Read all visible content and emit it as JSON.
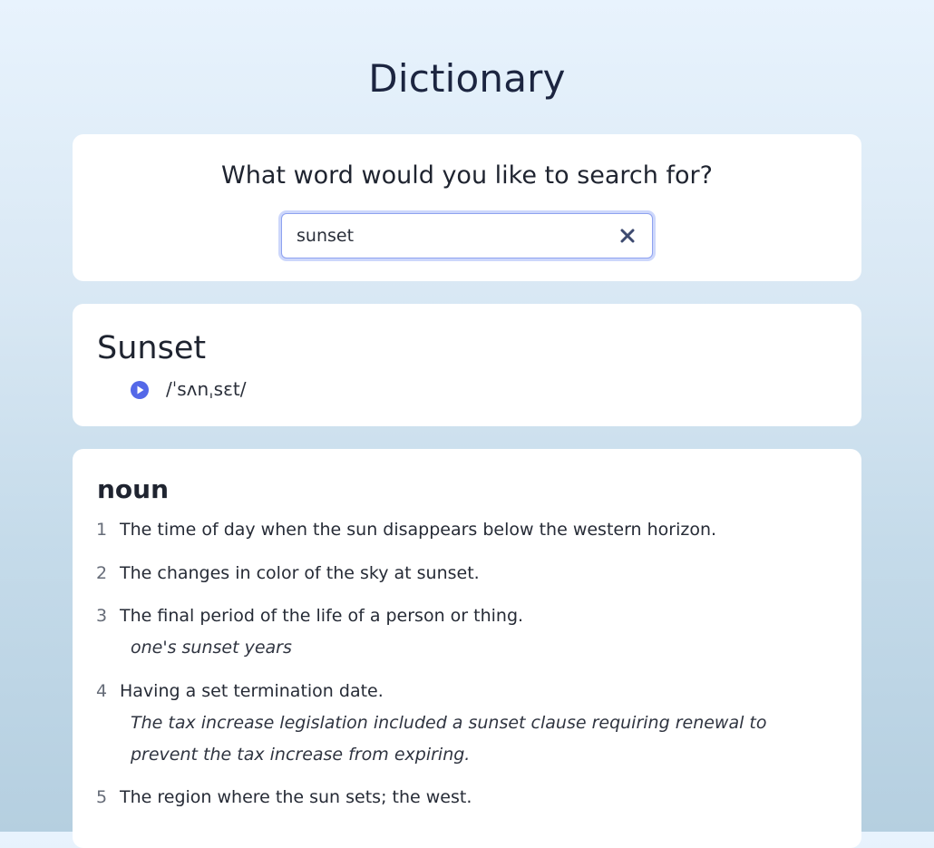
{
  "header": {
    "title": "Dictionary"
  },
  "search": {
    "prompt": "What word would you like to search for?",
    "value": "sunset",
    "clear_icon": "close-icon"
  },
  "entry": {
    "word": "Sunset",
    "phonetic": "/ˈsʌnˌsɛt/",
    "play_icon": "play-circle-icon",
    "accent_color": "#5468e8",
    "part_of_speech": "noun",
    "definitions": [
      {
        "number": "1",
        "text": "The time of day when the sun disappears below the western horizon."
      },
      {
        "number": "2",
        "text": "The changes in color of the sky at sunset."
      },
      {
        "number": "3",
        "text": "The final period of the life of a person or thing.",
        "example": "one's sunset years"
      },
      {
        "number": "4",
        "text": "Having a set termination date.",
        "example": "The tax increase legislation included a sunset clause requiring renewal to prevent the tax increase from expiring."
      },
      {
        "number": "5",
        "text": "The region where the sun sets; the west."
      }
    ]
  }
}
